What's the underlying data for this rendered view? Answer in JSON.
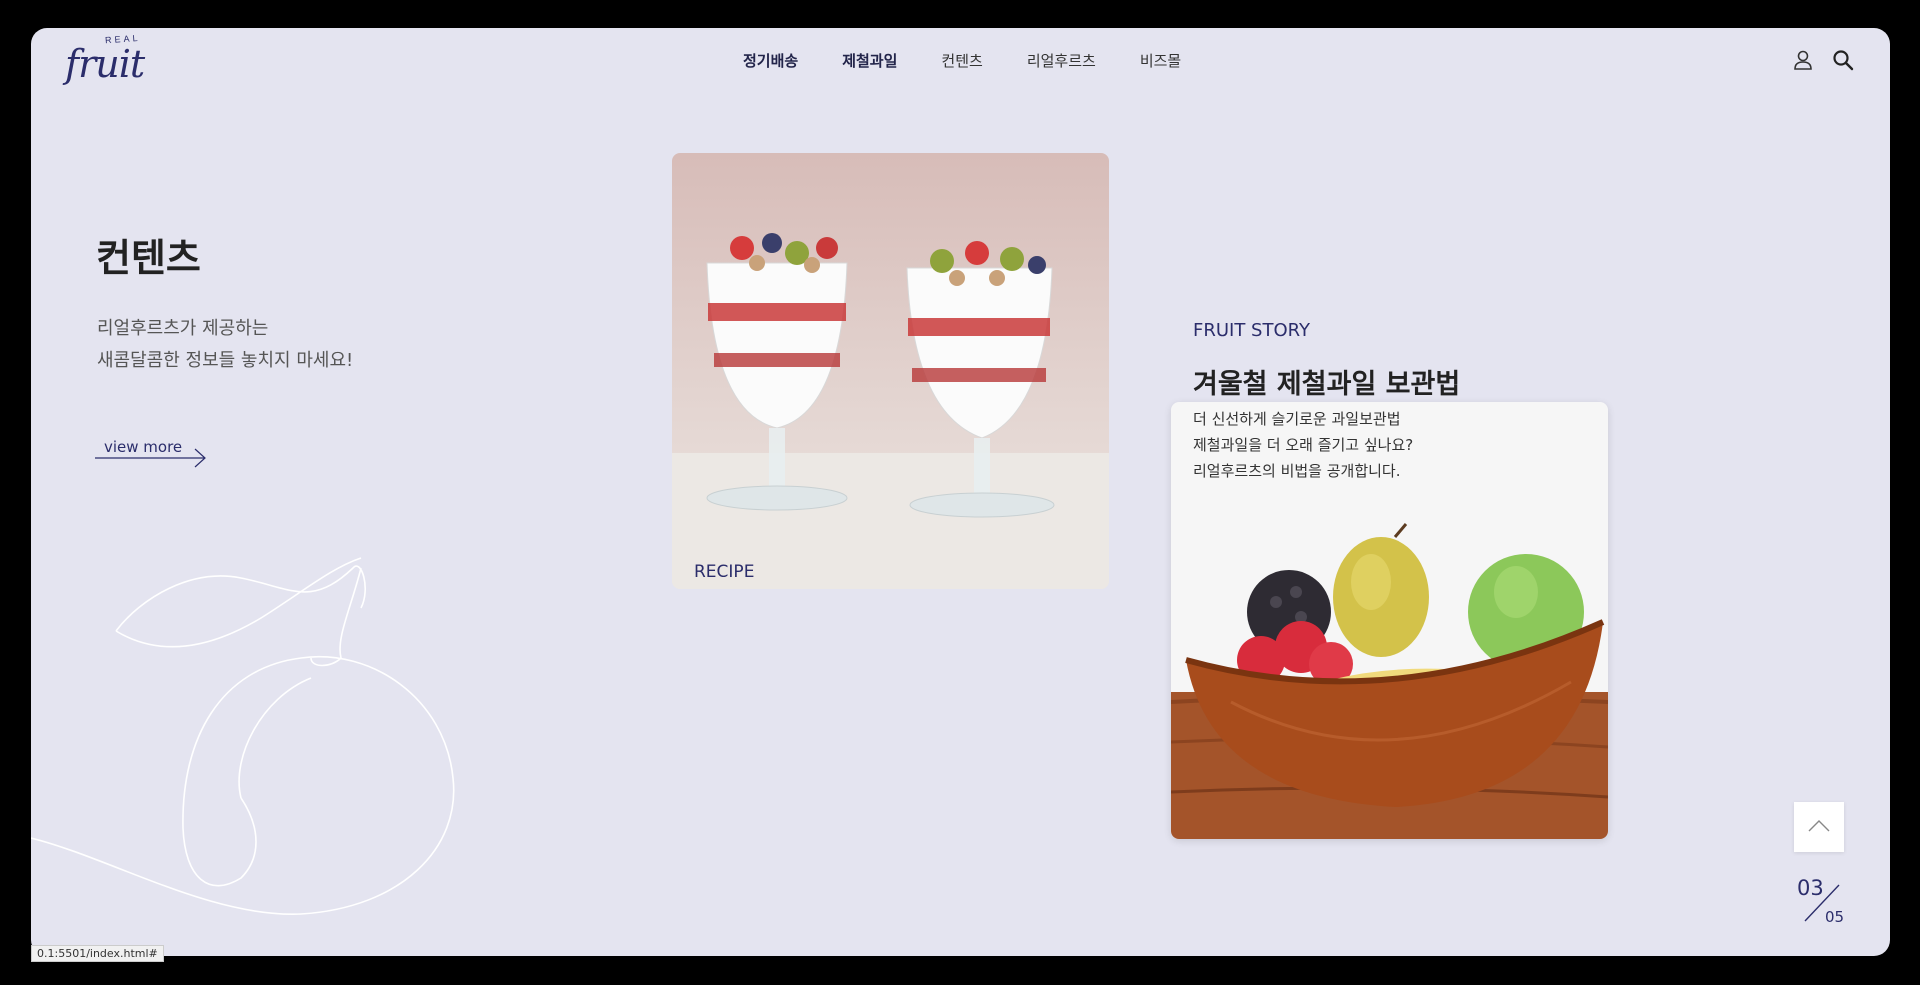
{
  "header": {
    "logo_small": "REAL",
    "logo_main": "fruit",
    "nav": [
      "정기배송",
      "제철과일",
      "컨텐츠",
      "리얼후르츠",
      "비즈몰"
    ],
    "icons": [
      "user-icon",
      "search-icon"
    ]
  },
  "intro": {
    "title": "컨텐츠",
    "desc_line1": "리얼후르츠가 제공하는",
    "desc_line2": "새콤달콤한 정보들 놓치지 마세요!",
    "view_more": "view more"
  },
  "recipe": {
    "label": "RECIPE"
  },
  "story": {
    "kicker": "FRUIT STORY",
    "title": "겨울철 제철과일 보관법",
    "line1": "더 신선하게 슬기로운 과일보관법",
    "line2": "제철과일을 더 오래 즐기고 싶나요?",
    "line3": "리얼후르츠의 비법을 공개합니다."
  },
  "pager": {
    "current": "03",
    "total": "05"
  },
  "status_url": "0.1:5501/index.html#",
  "colors": {
    "accent": "#2b2d6b",
    "background": "#e4e4f0"
  }
}
